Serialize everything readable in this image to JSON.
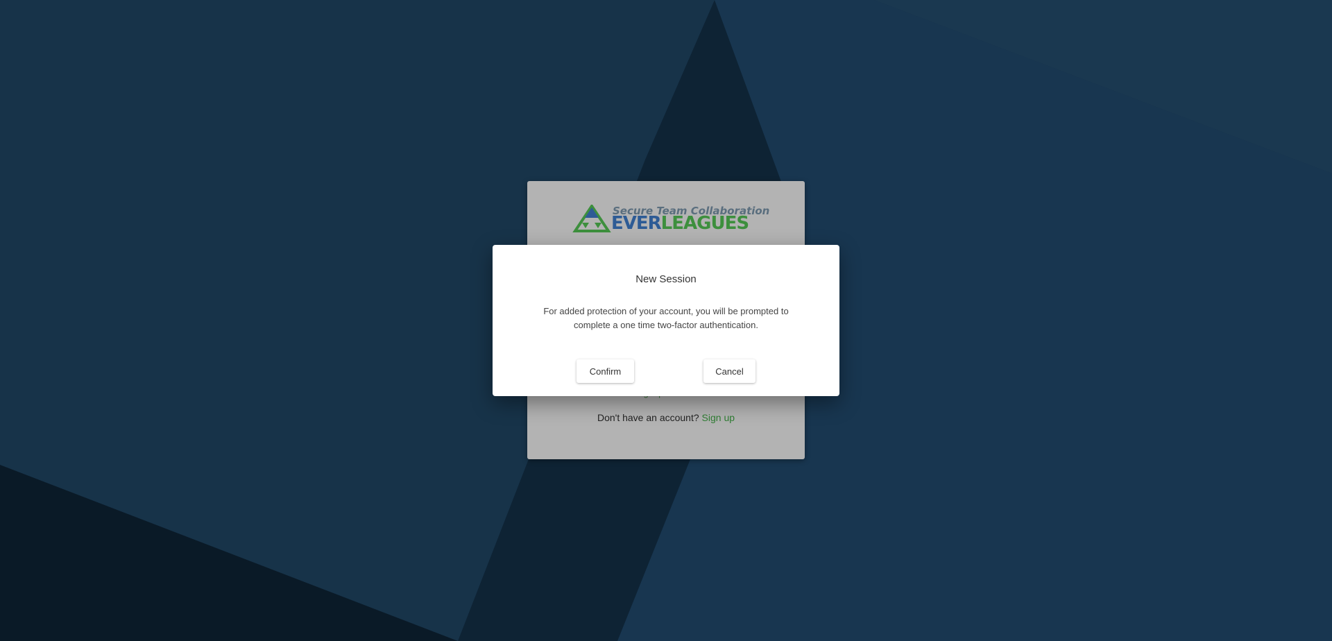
{
  "login": {
    "logo": {
      "tagline": "Secure Team Collaboration",
      "brand_part1": "EVER",
      "brand_part2": "LEAGUES"
    },
    "forgot_password": "Forgot password?",
    "no_account_text": "Don't have an account?",
    "signup_label": "Sign up"
  },
  "dialog": {
    "title": "New Session",
    "message": "For added protection of your account, you will be prompted to complete a one time two-factor authentication.",
    "confirm_label": "Confirm",
    "cancel_label": "Cancel"
  },
  "colors": {
    "background": "#17324a",
    "brand_blue": "#2d5b95",
    "brand_green": "#3d8f3d"
  }
}
